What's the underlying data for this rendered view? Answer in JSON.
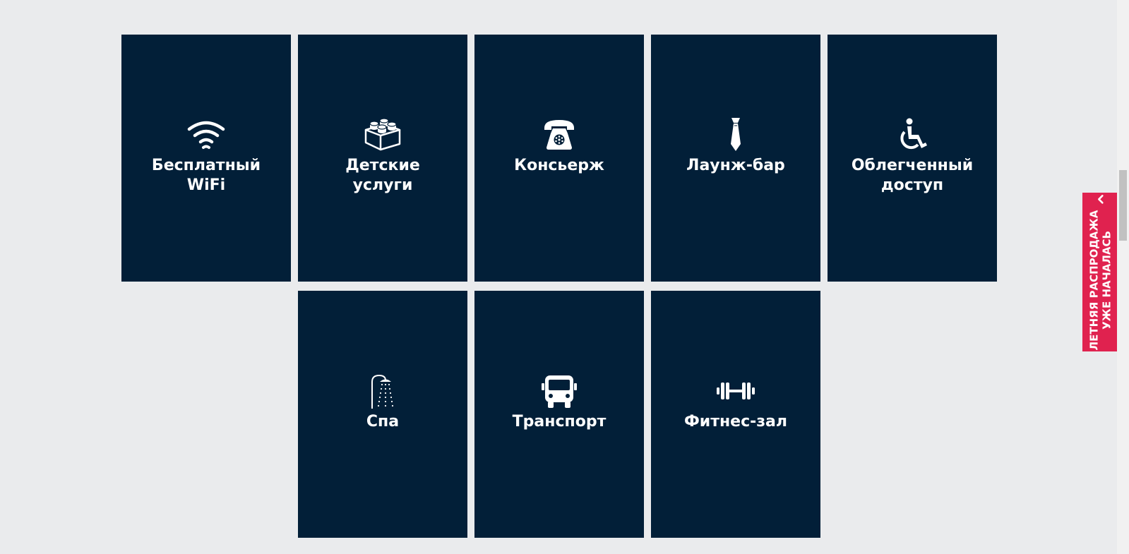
{
  "amenities": {
    "items": [
      {
        "label": "Бесплатный\nWiFi",
        "icon": "wifi-icon"
      },
      {
        "label": "Детские\nуслуги",
        "icon": "lego-brick-icon"
      },
      {
        "label": "Консьерж",
        "icon": "telephone-icon"
      },
      {
        "label": "Лаунж-бар",
        "icon": "necktie-icon"
      },
      {
        "label": "Облегченный\nдоступ",
        "icon": "wheelchair-icon"
      },
      {
        "label": "Спа",
        "icon": "shower-icon"
      },
      {
        "label": "Транспорт",
        "icon": "bus-icon"
      },
      {
        "label": "Фитнес-зал",
        "icon": "dumbbell-icon"
      }
    ]
  },
  "promo": {
    "line1": "ЛЕТНЯЯ РАСПРОДАЖА",
    "line2": "УЖЕ НАЧАЛАСЬ",
    "icon": "chevron-up-icon",
    "color": "#e0224f"
  },
  "colors": {
    "page_background": "#eaebed",
    "tile_background": "#021f38",
    "tile_text": "#ffffff"
  }
}
